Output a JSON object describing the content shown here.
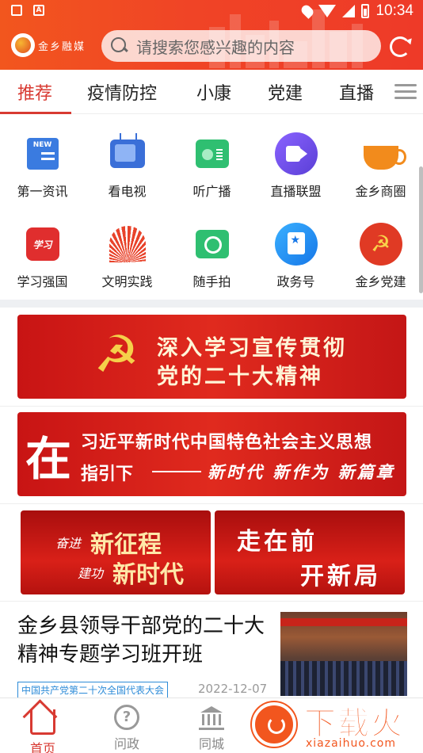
{
  "status_bar": {
    "time": "10:34"
  },
  "header": {
    "logo_text": "金乡融媒",
    "search_placeholder": "请搜索您感兴趣的内容"
  },
  "tabs": [
    {
      "label": "推荐",
      "active": true
    },
    {
      "label": "疫情防控",
      "active": false
    },
    {
      "label": "小康",
      "active": false
    },
    {
      "label": "党建",
      "active": false
    },
    {
      "label": "直播",
      "active": false
    }
  ],
  "grid": [
    {
      "label": "第一资讯",
      "icon": "news-icon",
      "icon_text": "NEW"
    },
    {
      "label": "看电视",
      "icon": "tv-icon"
    },
    {
      "label": "听广播",
      "icon": "radio-icon"
    },
    {
      "label": "直播联盟",
      "icon": "live-video-icon"
    },
    {
      "label": "金乡商圈",
      "icon": "coffee-cup-icon"
    },
    {
      "label": "学习强国",
      "icon": "study-icon",
      "icon_text": "学习"
    },
    {
      "label": "文明实践",
      "icon": "civilization-icon"
    },
    {
      "label": "随手拍",
      "icon": "camera-icon"
    },
    {
      "label": "政务号",
      "icon": "gov-account-icon"
    },
    {
      "label": "金乡党建",
      "icon": "party-emblem-icon"
    }
  ],
  "banners": {
    "b1": {
      "line1": "深入学习宣传贯彻",
      "line2": "党的二十大精神"
    },
    "b2": {
      "big": "在",
      "line1": "习近平新时代中国特色社会主义思想",
      "line2": "指引下",
      "line3": "新时代 新作为 新篇章"
    },
    "b3": {
      "a1": "奋进",
      "a2": "新征程",
      "a3": "建功",
      "a4": "新时代"
    },
    "b4": {
      "line1": "走在前",
      "line2": "开新局"
    }
  },
  "article": {
    "title": "金乡县领导干部党的二十大精神专题学习班开班",
    "tag": "中国共产党第二十次全国代表大会",
    "date": "2022-12-07"
  },
  "bottom_nav": [
    {
      "label": "首页",
      "icon": "home-icon",
      "active": true
    },
    {
      "label": "问政",
      "icon": "question-icon",
      "active": false
    },
    {
      "label": "同城",
      "icon": "bank-icon",
      "active": false
    }
  ],
  "watermark": {
    "text": "下载火",
    "url": "xiazaihuo.com"
  },
  "colors": {
    "accent": "#d83a32",
    "header": "#f04426"
  }
}
